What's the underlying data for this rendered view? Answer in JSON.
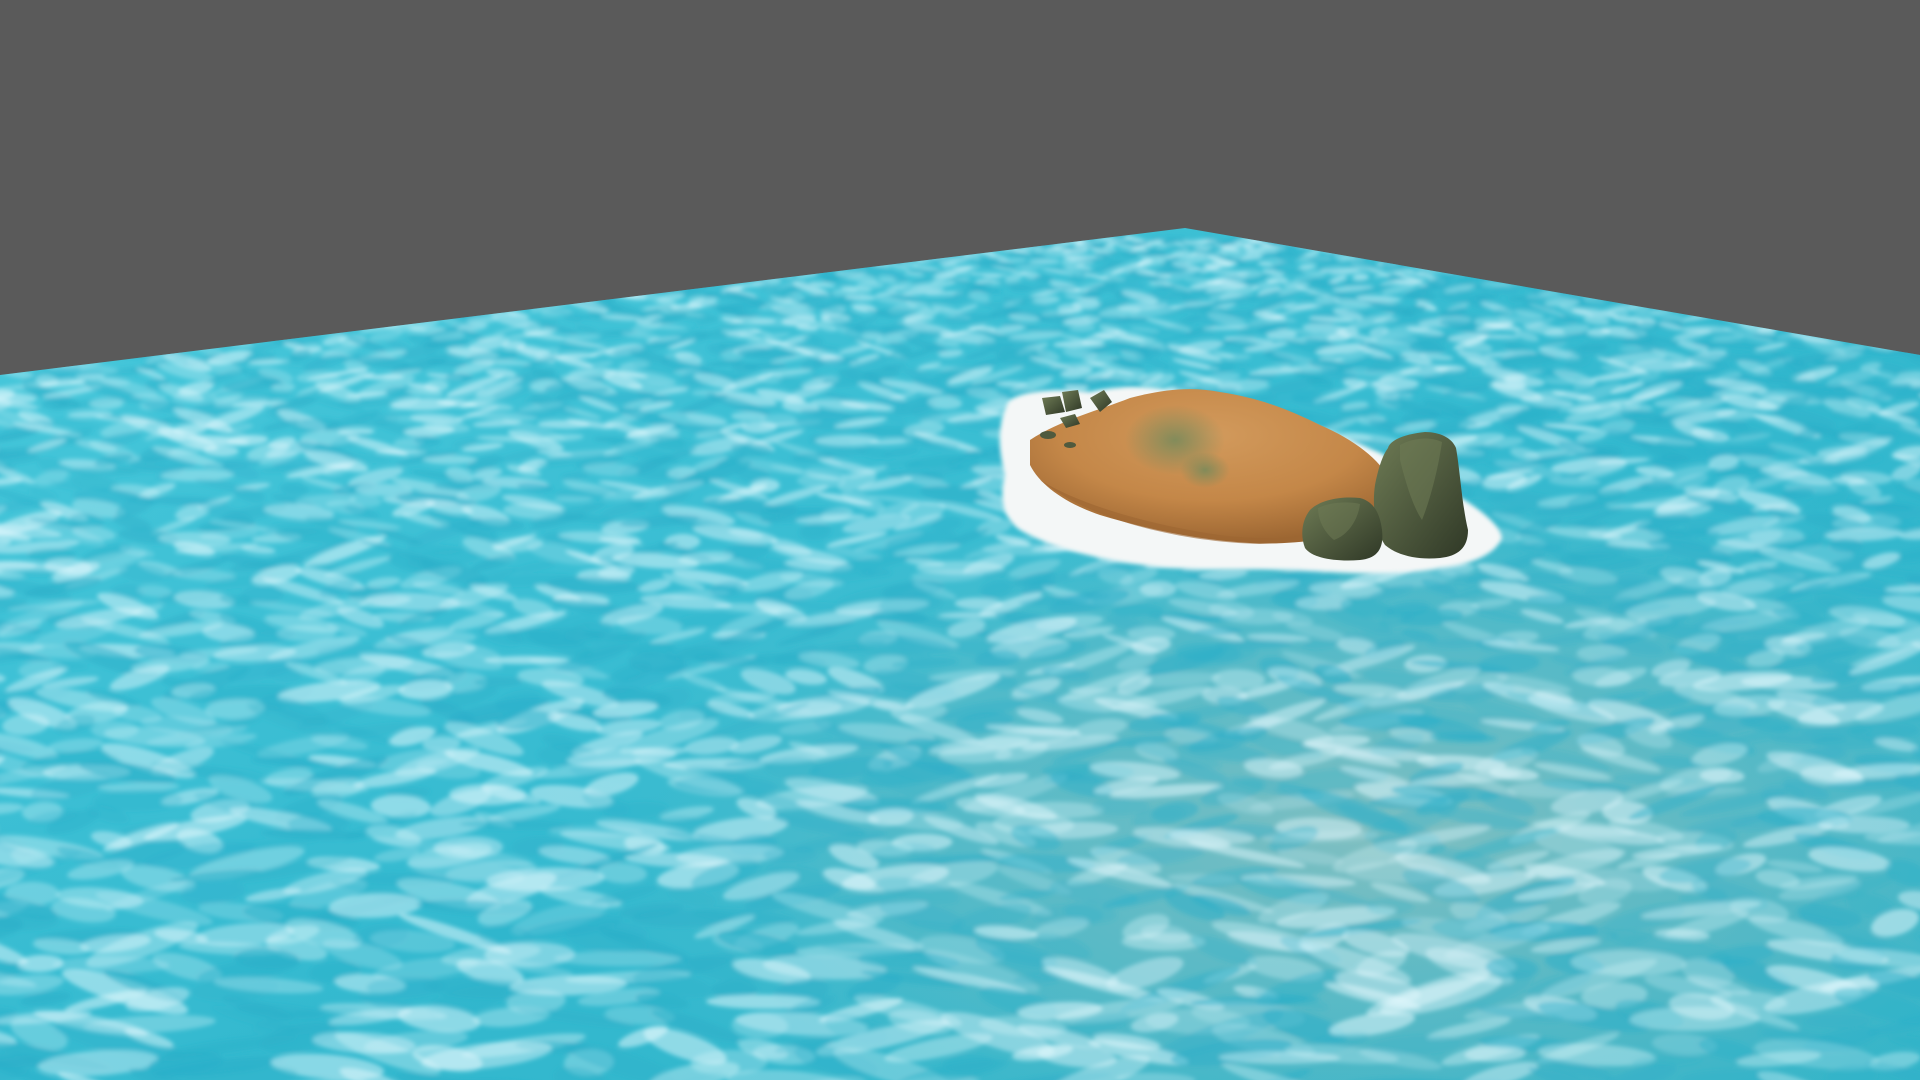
{
  "scene": {
    "kind": "3d-viewport-render",
    "background_color": "#5a5a5a",
    "water": {
      "shallow_color": "#3fc3d6",
      "deep_color": "#2aaec8",
      "highlight_color": "#e8fbff",
      "sand_tint": "#8fb9b4"
    },
    "island": {
      "sand_color": "#c98d4f",
      "sand_shadow_color": "#9c6632",
      "moss_color": "#7a8a5a",
      "foam_color": "#f4f7f7"
    },
    "rocks": {
      "color": "#4f5a3e",
      "highlight_color": "#6f7c55",
      "shadow_color": "#2f3826",
      "count": 6
    }
  }
}
